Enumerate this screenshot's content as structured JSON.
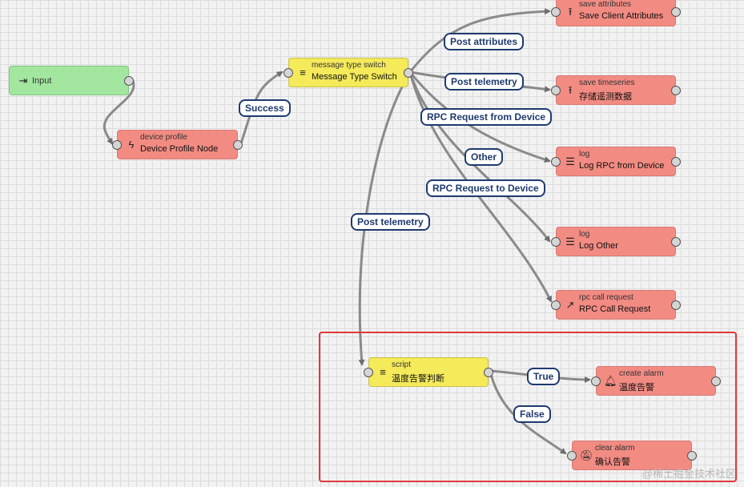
{
  "nodes": {
    "input": {
      "type": "Input",
      "icon": "input-icon"
    },
    "device_profile": {
      "type": "device profile",
      "name": "Device Profile Node",
      "icon": "bolt-icon"
    },
    "message_type_switch": {
      "type": "message type switch",
      "name": "Message Type Switch",
      "icon": "filter-icon"
    },
    "save_attributes": {
      "type": "save attributes",
      "name": "Save Client Attributes",
      "icon": "upload-icon"
    },
    "save_timeseries": {
      "type": "save timeseries",
      "name": "存储遥测数据",
      "icon": "upload-icon"
    },
    "log_rpc": {
      "type": "log",
      "name": "Log RPC from Device",
      "icon": "menu-icon"
    },
    "log_other": {
      "type": "log",
      "name": "Log Other",
      "icon": "menu-icon"
    },
    "rpc_call": {
      "type": "rpc call request",
      "name": "RPC Call Request",
      "icon": "arrow-up-right-icon"
    },
    "script": {
      "type": "script",
      "name": "温度告警判断",
      "icon": "filter-icon"
    },
    "create_alarm": {
      "type": "create alarm",
      "name": "温度告警",
      "icon": "bell-icon"
    },
    "clear_alarm": {
      "type": "clear alarm",
      "name": "确认告警",
      "icon": "bell-off-icon"
    }
  },
  "links": {
    "success": "Success",
    "post_attributes": "Post attributes",
    "post_telemetry_1": "Post telemetry",
    "rpc_from_device": "RPC Request from Device",
    "other": "Other",
    "rpc_to_device": "RPC Request to Device",
    "post_telemetry_2": "Post telemetry",
    "true": "True",
    "false": "False"
  },
  "colors": {
    "action": "#f28b82",
    "filter": "#f4ea5a",
    "input": "#a2e6a0",
    "link_border": "#1f3a6e",
    "highlight": "#e0393a"
  },
  "watermark": "@稀土掘金技术社区"
}
